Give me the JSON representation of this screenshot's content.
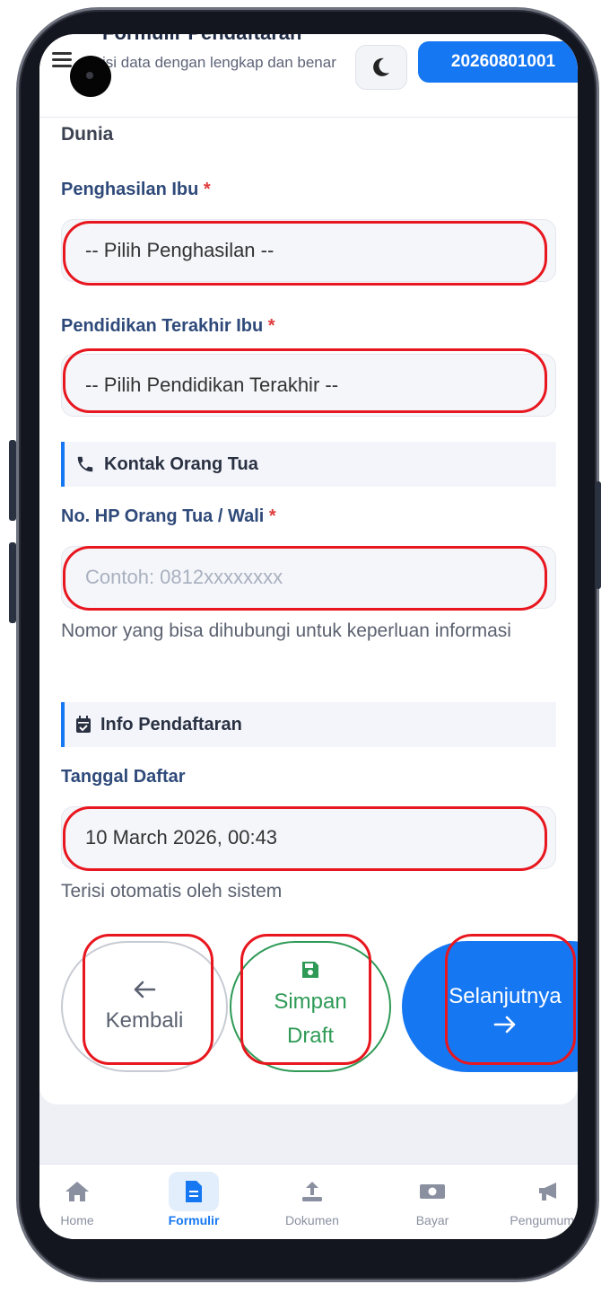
{
  "header": {
    "title": "Formulir Pendaftaran",
    "subtitle": "isi data dengan lengkap dan benar",
    "registration_id": "20260801001"
  },
  "content": {
    "section_partial_text": "Dunia",
    "mother_income": {
      "label": "Penghasilan Ibu",
      "required_mark": "*",
      "value": "-- Pilih Penghasilan --"
    },
    "mother_education": {
      "label": "Pendidikan Terakhir Ibu",
      "required_mark": "*",
      "value": "-- Pilih Pendidikan Terakhir --"
    },
    "parent_contact_section": {
      "title": "Kontak Orang Tua",
      "icon": "phone-icon"
    },
    "parent_phone": {
      "label": "No. HP Orang Tua / Wali",
      "required_mark": "*",
      "placeholder": "Contoh: 0812xxxxxxxx",
      "hint": "Nomor yang bisa dihubungi untuk keperluan informasi"
    },
    "registration_info_section": {
      "title": "Info Pendaftaran",
      "icon": "calendar-check-icon"
    },
    "registration_date": {
      "label": "Tanggal Daftar",
      "value": "10 March 2026, 00:43",
      "hint": "Terisi otomatis oleh sistem"
    }
  },
  "actions": {
    "back_label": "Kembali",
    "draft_label_line1": "Simpan",
    "draft_label_line2": "Draft",
    "next_label": "Selanjutnya"
  },
  "bottom_nav": {
    "items": [
      {
        "label": "Home",
        "icon": "home-icon"
      },
      {
        "label": "Formulir",
        "icon": "document-icon",
        "active": true
      },
      {
        "label": "Dokumen",
        "icon": "upload-icon"
      },
      {
        "label": "Bayar",
        "icon": "money-icon"
      },
      {
        "label": "Pengumuman",
        "icon": "megaphone-icon"
      }
    ]
  },
  "colors": {
    "primary": "#1677f2",
    "success": "#2e9a56",
    "required": "#e03b3b",
    "annotation": "#e8161e"
  }
}
